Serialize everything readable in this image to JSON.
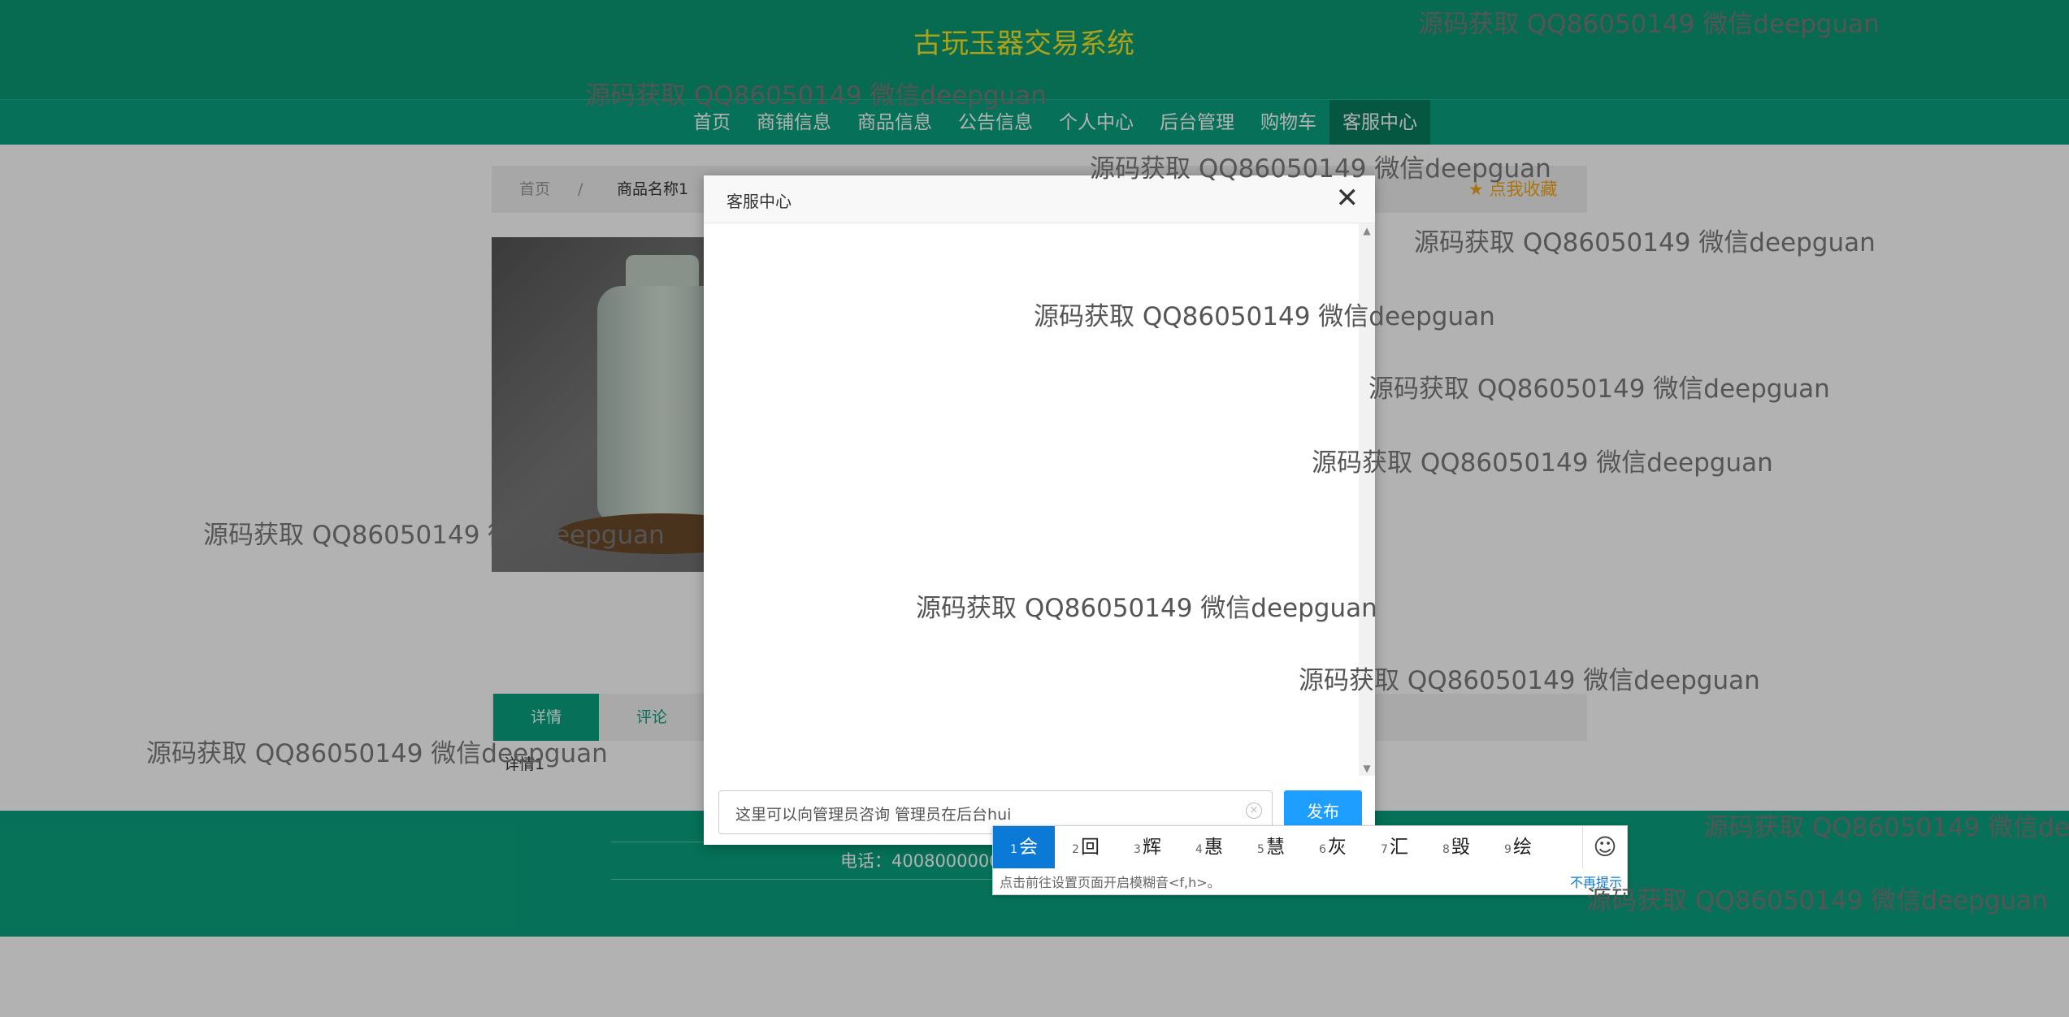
{
  "site": {
    "title": "古玩玉器交易系统"
  },
  "nav": {
    "items": [
      "首页",
      "商铺信息",
      "商品信息",
      "公告信息",
      "个人中心",
      "后台管理",
      "购物车",
      "客服中心"
    ],
    "active_index": 7
  },
  "breadcrumb": {
    "home": "首页",
    "separator": "/",
    "current": "商品名称1"
  },
  "favorite": {
    "label": "★ 点我收藏"
  },
  "tabs": {
    "detail": "详情",
    "comment": "评论"
  },
  "detail_text": "详情1",
  "footer": {
    "phone": "电话：4008000000"
  },
  "modal": {
    "title": "客服中心",
    "close_icon": "✕",
    "input_value": "这里可以向管理员咨询 管理员在后台hui",
    "publish_label": "发布"
  },
  "ime": {
    "candidates": [
      {
        "num": "1",
        "text": "会"
      },
      {
        "num": "2",
        "text": "回"
      },
      {
        "num": "3",
        "text": "辉"
      },
      {
        "num": "4",
        "text": "惠"
      },
      {
        "num": "5",
        "text": "慧"
      },
      {
        "num": "6",
        "text": "灰"
      },
      {
        "num": "7",
        "text": "汇"
      },
      {
        "num": "8",
        "text": "毁"
      },
      {
        "num": "9",
        "text": "绘"
      }
    ],
    "hint": "点击前往设置页面开启模糊音<f,h>。",
    "dismiss": "不再提示"
  },
  "watermark": "源码获取 QQ86050149 微信deepguan",
  "colors": {
    "header": "#0a9a74",
    "nav": "#0aa37e",
    "title": "#f4e829",
    "accent": "#1e9fff"
  }
}
